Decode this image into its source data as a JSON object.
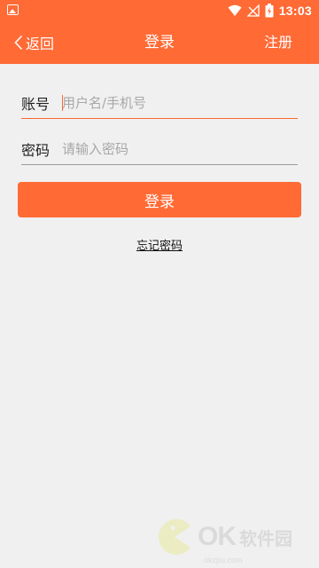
{
  "status_bar": {
    "time": "13:03"
  },
  "appbar": {
    "back_label": "返回",
    "title": "登录",
    "register_label": "注册"
  },
  "form": {
    "account_label": "账号",
    "account_placeholder": "用户名/手机号",
    "password_label": "密码",
    "password_placeholder": "请输入密码",
    "login_label": "登录",
    "forgot_label": "忘记密码"
  },
  "watermark": {
    "brand": "OK",
    "cn": "软件园",
    "url": "okzpu.com"
  },
  "colors": {
    "accent": "#ff6a35",
    "background": "#f0f0f0"
  }
}
